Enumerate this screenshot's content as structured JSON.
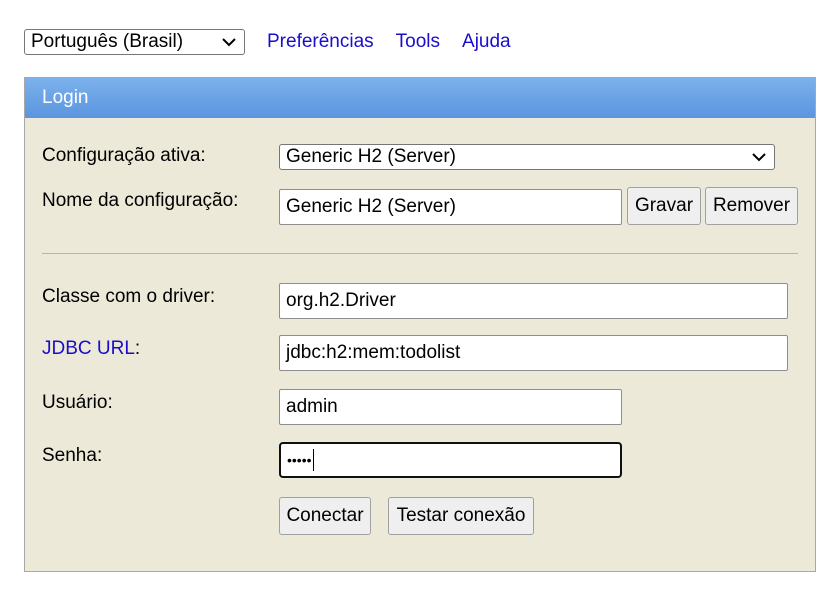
{
  "topbar": {
    "language": "Português (Brasil)",
    "links": [
      "Preferências",
      "Tools",
      "Ajuda"
    ]
  },
  "panel": {
    "title": "Login",
    "active_config_label": "Configuração ativa:",
    "active_config_value": "Generic H2 (Server)",
    "config_name_label": "Nome da configuração:",
    "config_name_value": "Generic H2 (Server)",
    "save_label": "Gravar",
    "remove_label": "Remover",
    "driver_label": "Classe com o driver:",
    "driver_value": "org.h2.Driver",
    "jdbc_label": "JDBC URL",
    "jdbc_suffix": ":",
    "jdbc_value": "jdbc:h2:mem:todolist",
    "user_label": "Usuário:",
    "user_value": "admin",
    "password_label": "Senha:",
    "password_value": "•••••",
    "connect_label": "Conectar",
    "test_label": "Testar conexão"
  },
  "colors": {
    "panel_bg": "#ece9d8",
    "header_bg": "#6aa3e6",
    "link": "#1a0dcc"
  }
}
